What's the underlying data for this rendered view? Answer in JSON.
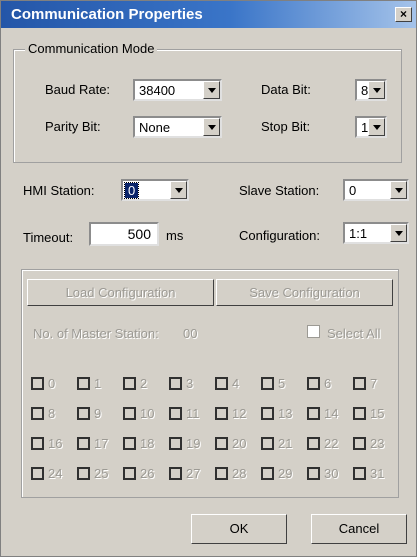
{
  "window": {
    "title": "Communication Properties",
    "close_glyph": "×"
  },
  "comm_mode": {
    "legend": "Communication Mode",
    "baud_rate": {
      "label": "Baud Rate:",
      "value": "38400"
    },
    "data_bit": {
      "label": "Data Bit:",
      "value": "8"
    },
    "parity_bit": {
      "label": "Parity Bit:",
      "value": "None"
    },
    "stop_bit": {
      "label": "Stop Bit:",
      "value": "1"
    }
  },
  "hmi_station": {
    "label": "HMI Station:",
    "value": "0"
  },
  "slave_station": {
    "label": "Slave Station:",
    "value": "0"
  },
  "timeout": {
    "label": "Timeout:",
    "value": "500",
    "unit": "ms"
  },
  "configuration": {
    "label": "Configuration:",
    "value": "1:1"
  },
  "buttons": {
    "load": "Load Configuration",
    "save": "Save Configuration",
    "ok": "OK",
    "cancel": "Cancel"
  },
  "master": {
    "label": "No. of Master Station:",
    "value": "00",
    "select_all": "Select All"
  },
  "stations": [
    "0",
    "1",
    "2",
    "3",
    "4",
    "5",
    "6",
    "7",
    "8",
    "9",
    "10",
    "11",
    "12",
    "13",
    "14",
    "15",
    "16",
    "17",
    "18",
    "19",
    "20",
    "21",
    "22",
    "23",
    "24",
    "25",
    "26",
    "27",
    "28",
    "29",
    "30",
    "31"
  ],
  "colors": {
    "titlebar_start": "#2456a8",
    "titlebar_end": "#a6c4ea",
    "face": "#d4d0c8",
    "disabled_text": "#9c9a94"
  }
}
